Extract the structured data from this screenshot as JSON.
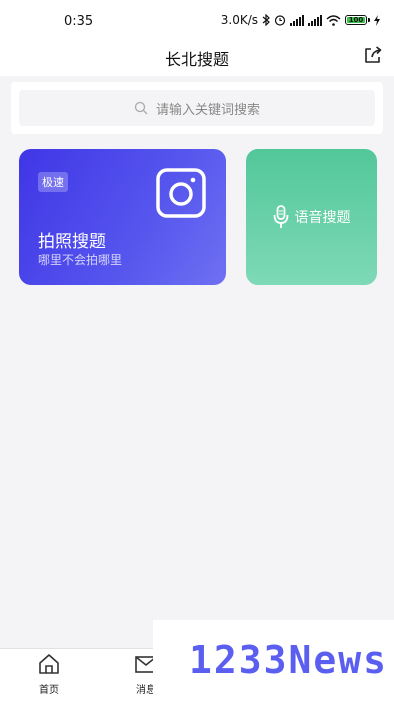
{
  "status": {
    "time": "0:35",
    "speed": "3.0K/s",
    "battery": "100"
  },
  "header": {
    "title": "长北搜题"
  },
  "search": {
    "placeholder": "请输入关键词搜索"
  },
  "photo_card": {
    "badge": "极速",
    "title": "拍照搜题",
    "subtitle": "哪里不会拍哪里"
  },
  "voice_card": {
    "title": "语音搜题"
  },
  "tabs": [
    {
      "label": "首页"
    },
    {
      "label": "消息"
    }
  ],
  "watermark": {
    "text": "1233News"
  },
  "colors": {
    "photo_card": "#4a46ea",
    "voice_card": "#62cfa5",
    "watermark": "#5b5ff0"
  }
}
